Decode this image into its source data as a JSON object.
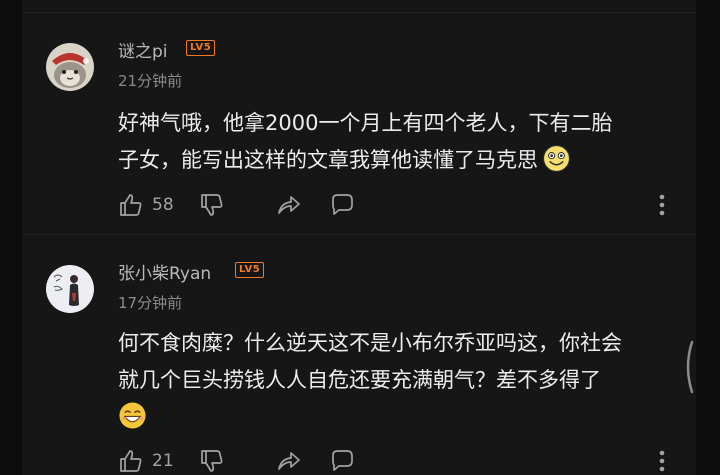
{
  "comments": [
    {
      "username": "谜之pi",
      "level": "LV5",
      "time": "21分钟前",
      "lines": [
        "好神气哦，他拿2000一个月上有四个老人，下有二胎",
        "子女，能写出这样的文章我算他读懂了马克思"
      ],
      "emoji": "smile-emoji",
      "likes": "58",
      "avatar": "cat-avatar"
    },
    {
      "username": "张小柴Ryan",
      "level": "LV5",
      "time": "17分钟前",
      "lines": [
        "何不食肉糜？什么逆天这不是小布尔乔亚吗这，你社会",
        "就几个巨头捞钱人人自危还要充满朝气？差不多得了"
      ],
      "emoji": "grin-emoji",
      "likes": "21",
      "avatar": "sketch-avatar"
    }
  ],
  "colors": {
    "background": "#161617",
    "level_badge": "#f27a1c",
    "username": "#b9b9bb",
    "text": "#ececed"
  }
}
